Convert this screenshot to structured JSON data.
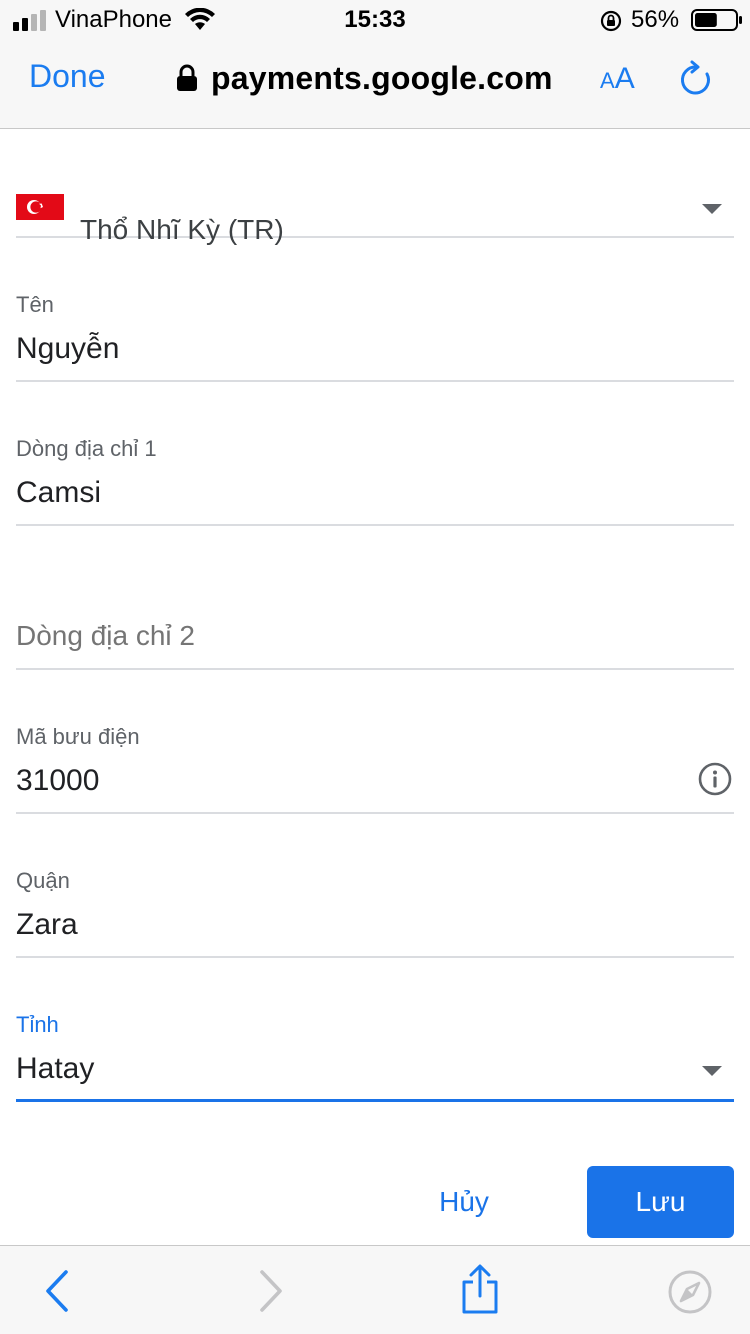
{
  "status_bar": {
    "carrier": "VinaPhone",
    "time": "15:33",
    "battery_percent": "56%",
    "battery_level": 0.56
  },
  "browser": {
    "done_label": "Done",
    "url": "payments.google.com",
    "aa_small": "A",
    "aa_big": "A"
  },
  "form": {
    "country": {
      "value": "Thổ Nhĩ Kỳ (TR)",
      "flag": "turkey-flag"
    },
    "name": {
      "label": "Tên",
      "value": "Nguyễn"
    },
    "address_line_1": {
      "label": "Dòng địa chỉ 1",
      "value": "Camsi"
    },
    "address_line_2": {
      "placeholder": "Dòng địa chỉ 2"
    },
    "postal_code": {
      "label": "Mã bưu điện",
      "value": "31000"
    },
    "district": {
      "label": "Quận",
      "value": "Zara"
    },
    "province": {
      "label": "Tỉnh",
      "value": "Hatay"
    }
  },
  "actions": {
    "cancel_label": "Hủy",
    "save_label": "Lưu"
  },
  "colors": {
    "ios_blue": "#1b7cf0",
    "google_blue": "#1a73e8",
    "divider": "#dadce0",
    "turkey_red": "#e30a17"
  }
}
